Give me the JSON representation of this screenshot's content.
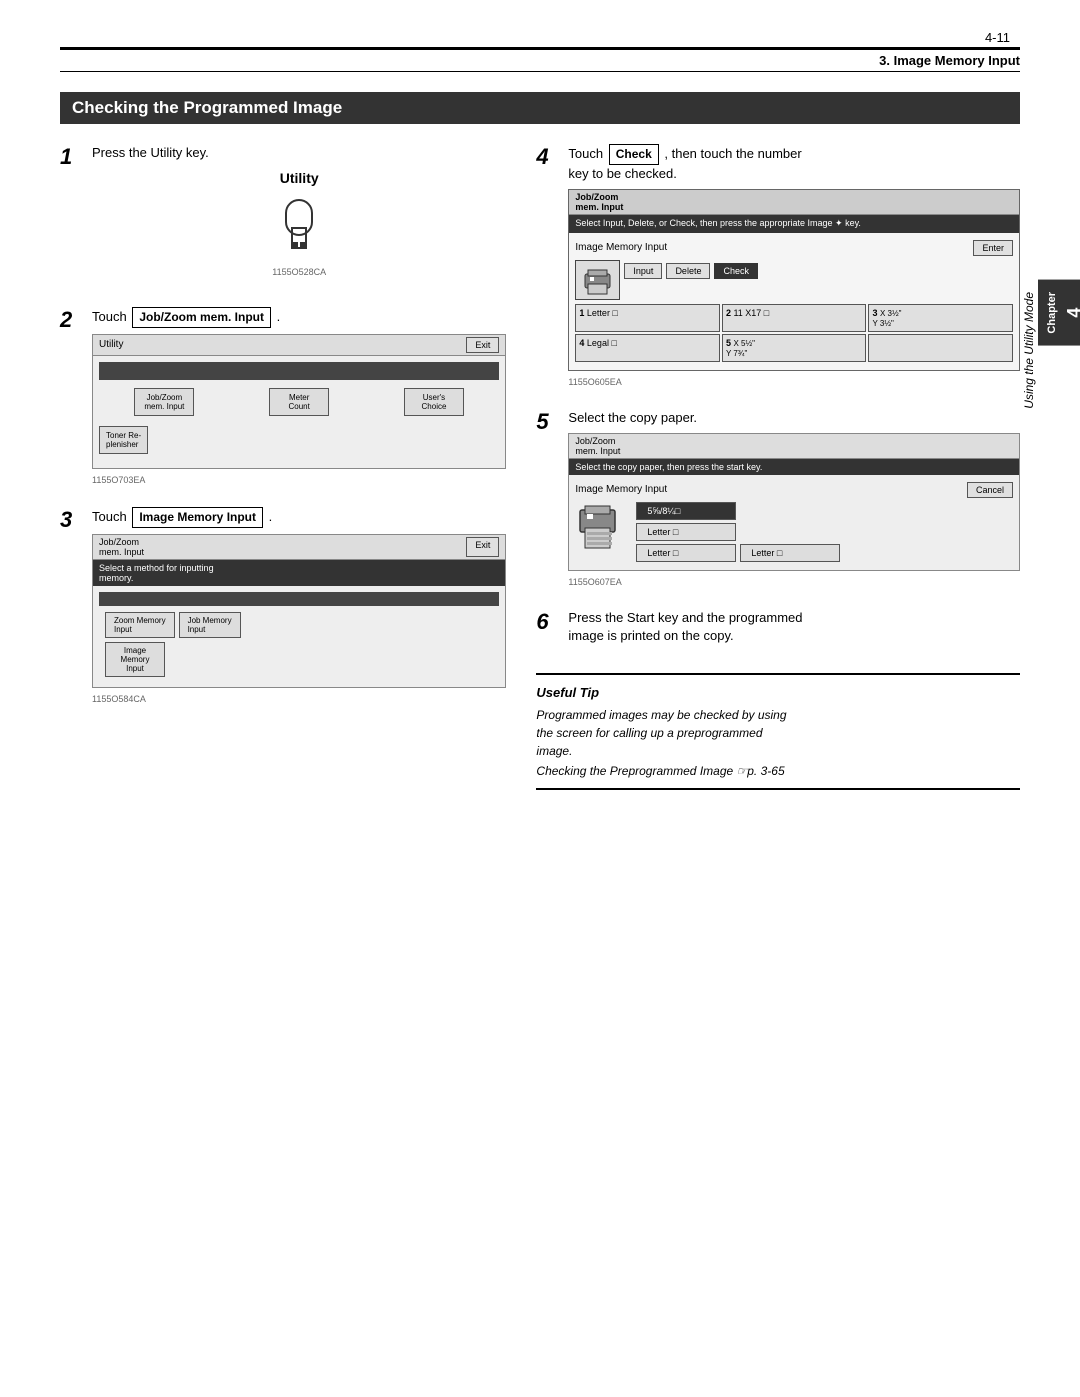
{
  "page": {
    "number": "4-11",
    "header_title": "3. Image Memory Input",
    "chapter_label": "Chapter",
    "chapter_number": "4",
    "side_text": "Using the Utility Mode"
  },
  "section": {
    "title": "Checking the Programmed Image"
  },
  "steps": {
    "step1": {
      "number": "1",
      "text": "Press the Utility key.",
      "diagram_label": "Utility",
      "diagram_code": "1155O528CA"
    },
    "step2": {
      "number": "2",
      "text": "Touch",
      "button_label": "Job/Zoom mem. Input",
      "period": ".",
      "screen_title": "Utility",
      "exit_btn": "Exit",
      "btn1": "Job/Zoom\nmem. Input",
      "btn2": "Meter\nCount",
      "btn3": "User's\nChoice",
      "btn4": "Toner Re-\nplenisher",
      "screen_code": "1155O703EA"
    },
    "step3": {
      "number": "3",
      "text": "Touch",
      "button_label": "Image Memory Input",
      "period": ".",
      "screen_title": "Job/Zoom\nmem. Input",
      "exit_btn": "Exit",
      "instruction": "Select a method for inputting\nmemory.",
      "btn1": "Zoom Memory\nInput",
      "btn2": "Job Memory\nInput",
      "btn3": "Image\nMemory Input",
      "screen_code": "1155O584CA"
    },
    "step4": {
      "number": "4",
      "text": "Touch",
      "button_label": "Check",
      "text2": ", then touch the number\nkey to be checked.",
      "screen_title": "Job/Zoom\nmem. Input",
      "instruction": "Select Input, Delete, or Check, then\npress the appropriate Image ✦ key.",
      "row_label": "Image Memory Input",
      "enter_btn": "Enter",
      "input_btn": "Input",
      "delete_btn": "Delete",
      "check_btn": "Check",
      "grid": [
        {
          "num": "1",
          "label": "Letter",
          "icon": "□"
        },
        {
          "num": "2",
          "label": "11 X17",
          "icon": "□"
        },
        {
          "num": "3",
          "label": "X 3½\"\nY 3½\""
        },
        {
          "num": "4",
          "label": "Legal",
          "icon": "□"
        },
        {
          "num": "5",
          "label": "X 5½\"\nY 7¾\""
        }
      ],
      "screen_code": "1155O605EA"
    },
    "step5": {
      "number": "5",
      "text": "Select the copy paper.",
      "screen_title": "Job/Zoom\nmem. Input",
      "instruction": "Select the copy paper, then\npress the start key.",
      "row_label": "Image Memory Input",
      "cancel_btn": "Cancel",
      "paper1": "5⅝/8¼□",
      "paper2": "Letter □",
      "paper3": "Letter □",
      "paper4": "Letter □",
      "screen_code": "1155O607EA"
    },
    "step6": {
      "number": "6",
      "text": "Press the Start key and the programmed\nimage is printed on the copy."
    }
  },
  "useful_tip": {
    "title": "Useful Tip",
    "text": "Programmed images may be checked by using\nthe screen for calling up a preprogrammed\nimage.",
    "link": "Checking the Preprogrammed Image ☞p. 3-65"
  }
}
